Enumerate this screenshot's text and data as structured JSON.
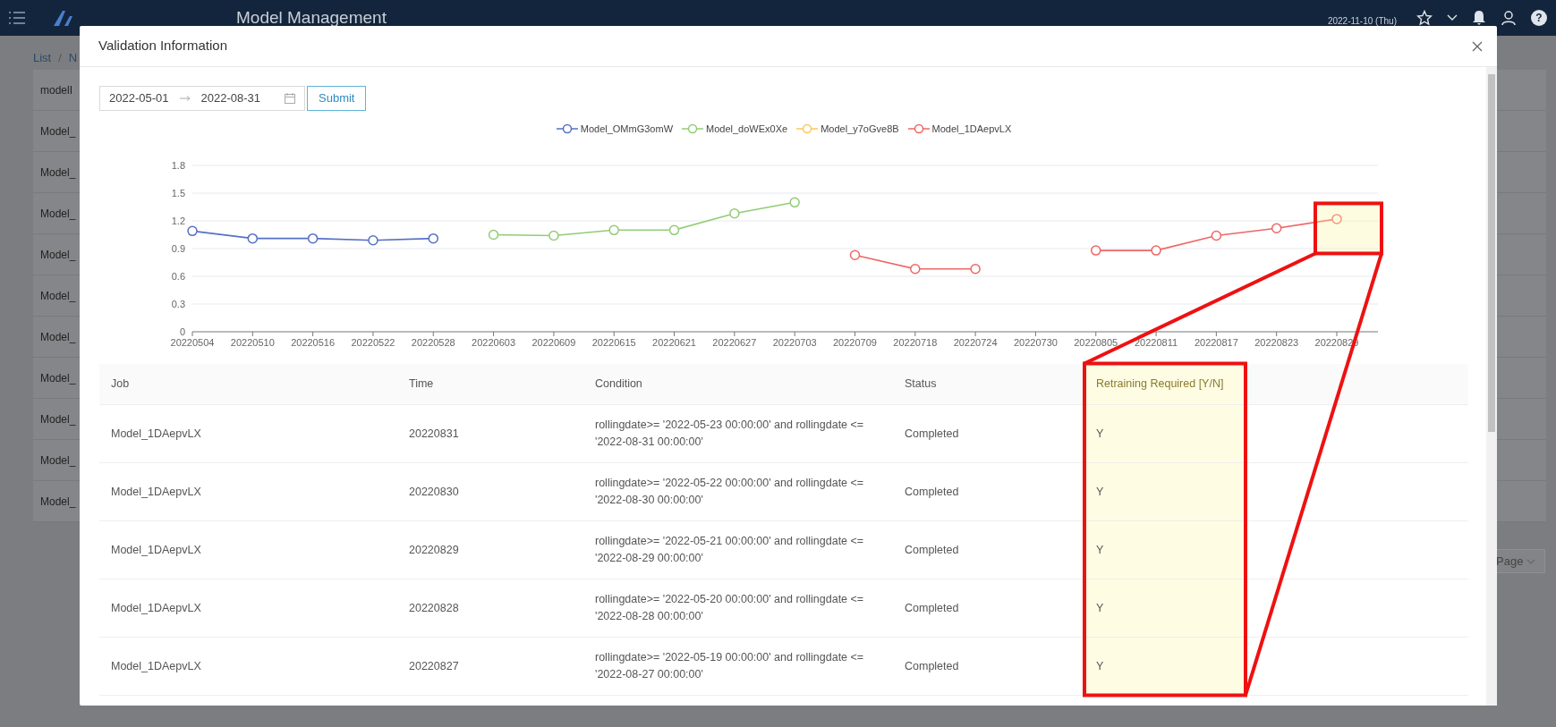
{
  "topbar": {
    "title": "Model Management",
    "date": "2022-11-10 (Thu)",
    "help": "?"
  },
  "background": {
    "breadcrumb": [
      "List",
      "/",
      "N"
    ],
    "rows": [
      "modelI",
      "Model_",
      "Model_",
      "Model_",
      "Model_",
      "Model_",
      "Model_",
      "Model_",
      "Model_",
      "Model_",
      "Model_"
    ],
    "pagination": "Page"
  },
  "dialog": {
    "title": "Validation Information",
    "date_from": "2022-05-01",
    "date_to": "2022-08-31",
    "submit": "Submit",
    "chart_data": {
      "type": "line",
      "grid": true,
      "legend": true,
      "categories": [
        "20220504",
        "20220510",
        "20220516",
        "20220522",
        "20220528",
        "20220603",
        "20220609",
        "20220615",
        "20220621",
        "20220627",
        "20220703",
        "20220709",
        "20220718",
        "20220724",
        "20220730",
        "20220805",
        "20220811",
        "20220817",
        "20220823",
        "20220829"
      ],
      "ylim": [
        0,
        1.8
      ],
      "yticks": [
        0,
        0.3,
        0.6,
        0.9,
        1.2,
        1.5,
        1.8
      ],
      "series": [
        {
          "name": "Model_OMmG3omW",
          "color": "#5470c6",
          "marker": "circle",
          "values": [
            1.09,
            1.01,
            1.01,
            0.99,
            1.01,
            null,
            null,
            null,
            null,
            null,
            null,
            null,
            null,
            null,
            null,
            null,
            null,
            null,
            null,
            null
          ]
        },
        {
          "name": "Model_doWEx0Xe",
          "color": "#91cc75",
          "marker": "circle",
          "values": [
            null,
            null,
            null,
            null,
            null,
            1.05,
            1.04,
            1.1,
            1.1,
            1.28,
            1.4,
            null,
            null,
            null,
            null,
            null,
            null,
            null,
            null,
            null
          ]
        },
        {
          "name": "Model_y7oGve8B",
          "color": "#fac858",
          "values": [
            null,
            null,
            null,
            null,
            null,
            null,
            null,
            null,
            null,
            null,
            null,
            null,
            null,
            null,
            null,
            null,
            null,
            null,
            null,
            null
          ]
        },
        {
          "name": "Model_1DAepvLX",
          "color": "#ee6666",
          "marker": "circle",
          "values": [
            null,
            null,
            null,
            null,
            null,
            null,
            null,
            null,
            null,
            null,
            null,
            0.83,
            0.68,
            0.68,
            null,
            0.88,
            0.88,
            1.04,
            1.12,
            1.22
          ]
        }
      ]
    },
    "table": {
      "columns": [
        {
          "label": "Job",
          "highlighted": false
        },
        {
          "label": "Time",
          "highlighted": false
        },
        {
          "label": "Condition",
          "highlighted": false
        },
        {
          "label": "Status",
          "highlighted": false
        },
        {
          "label": "Retraining Required [Y/N]",
          "highlighted": true
        }
      ],
      "rows": [
        [
          "Model_1DAepvLX",
          "20220831",
          "rollingdate>= '2022-05-23 00:00:00' and rollingdate <= '2022-08-31 00:00:00'",
          "Completed",
          "Y"
        ],
        [
          "Model_1DAepvLX",
          "20220830",
          "rollingdate>= '2022-05-22 00:00:00' and rollingdate <= '2022-08-30 00:00:00'",
          "Completed",
          "Y"
        ],
        [
          "Model_1DAepvLX",
          "20220829",
          "rollingdate>= '2022-05-21 00:00:00' and rollingdate <= '2022-08-29 00:00:00'",
          "Completed",
          "Y"
        ],
        [
          "Model_1DAepvLX",
          "20220828",
          "rollingdate>= '2022-05-20 00:00:00' and rollingdate <= '2022-08-28 00:00:00'",
          "Completed",
          "Y"
        ],
        [
          "Model_1DAepvLX",
          "20220827",
          "rollingdate>= '2022-05-19 00:00:00' and rollingdate <= '2022-08-27 00:00:00'",
          "Completed",
          "Y"
        ]
      ]
    }
  },
  "callout": {
    "kind": "zoom"
  }
}
